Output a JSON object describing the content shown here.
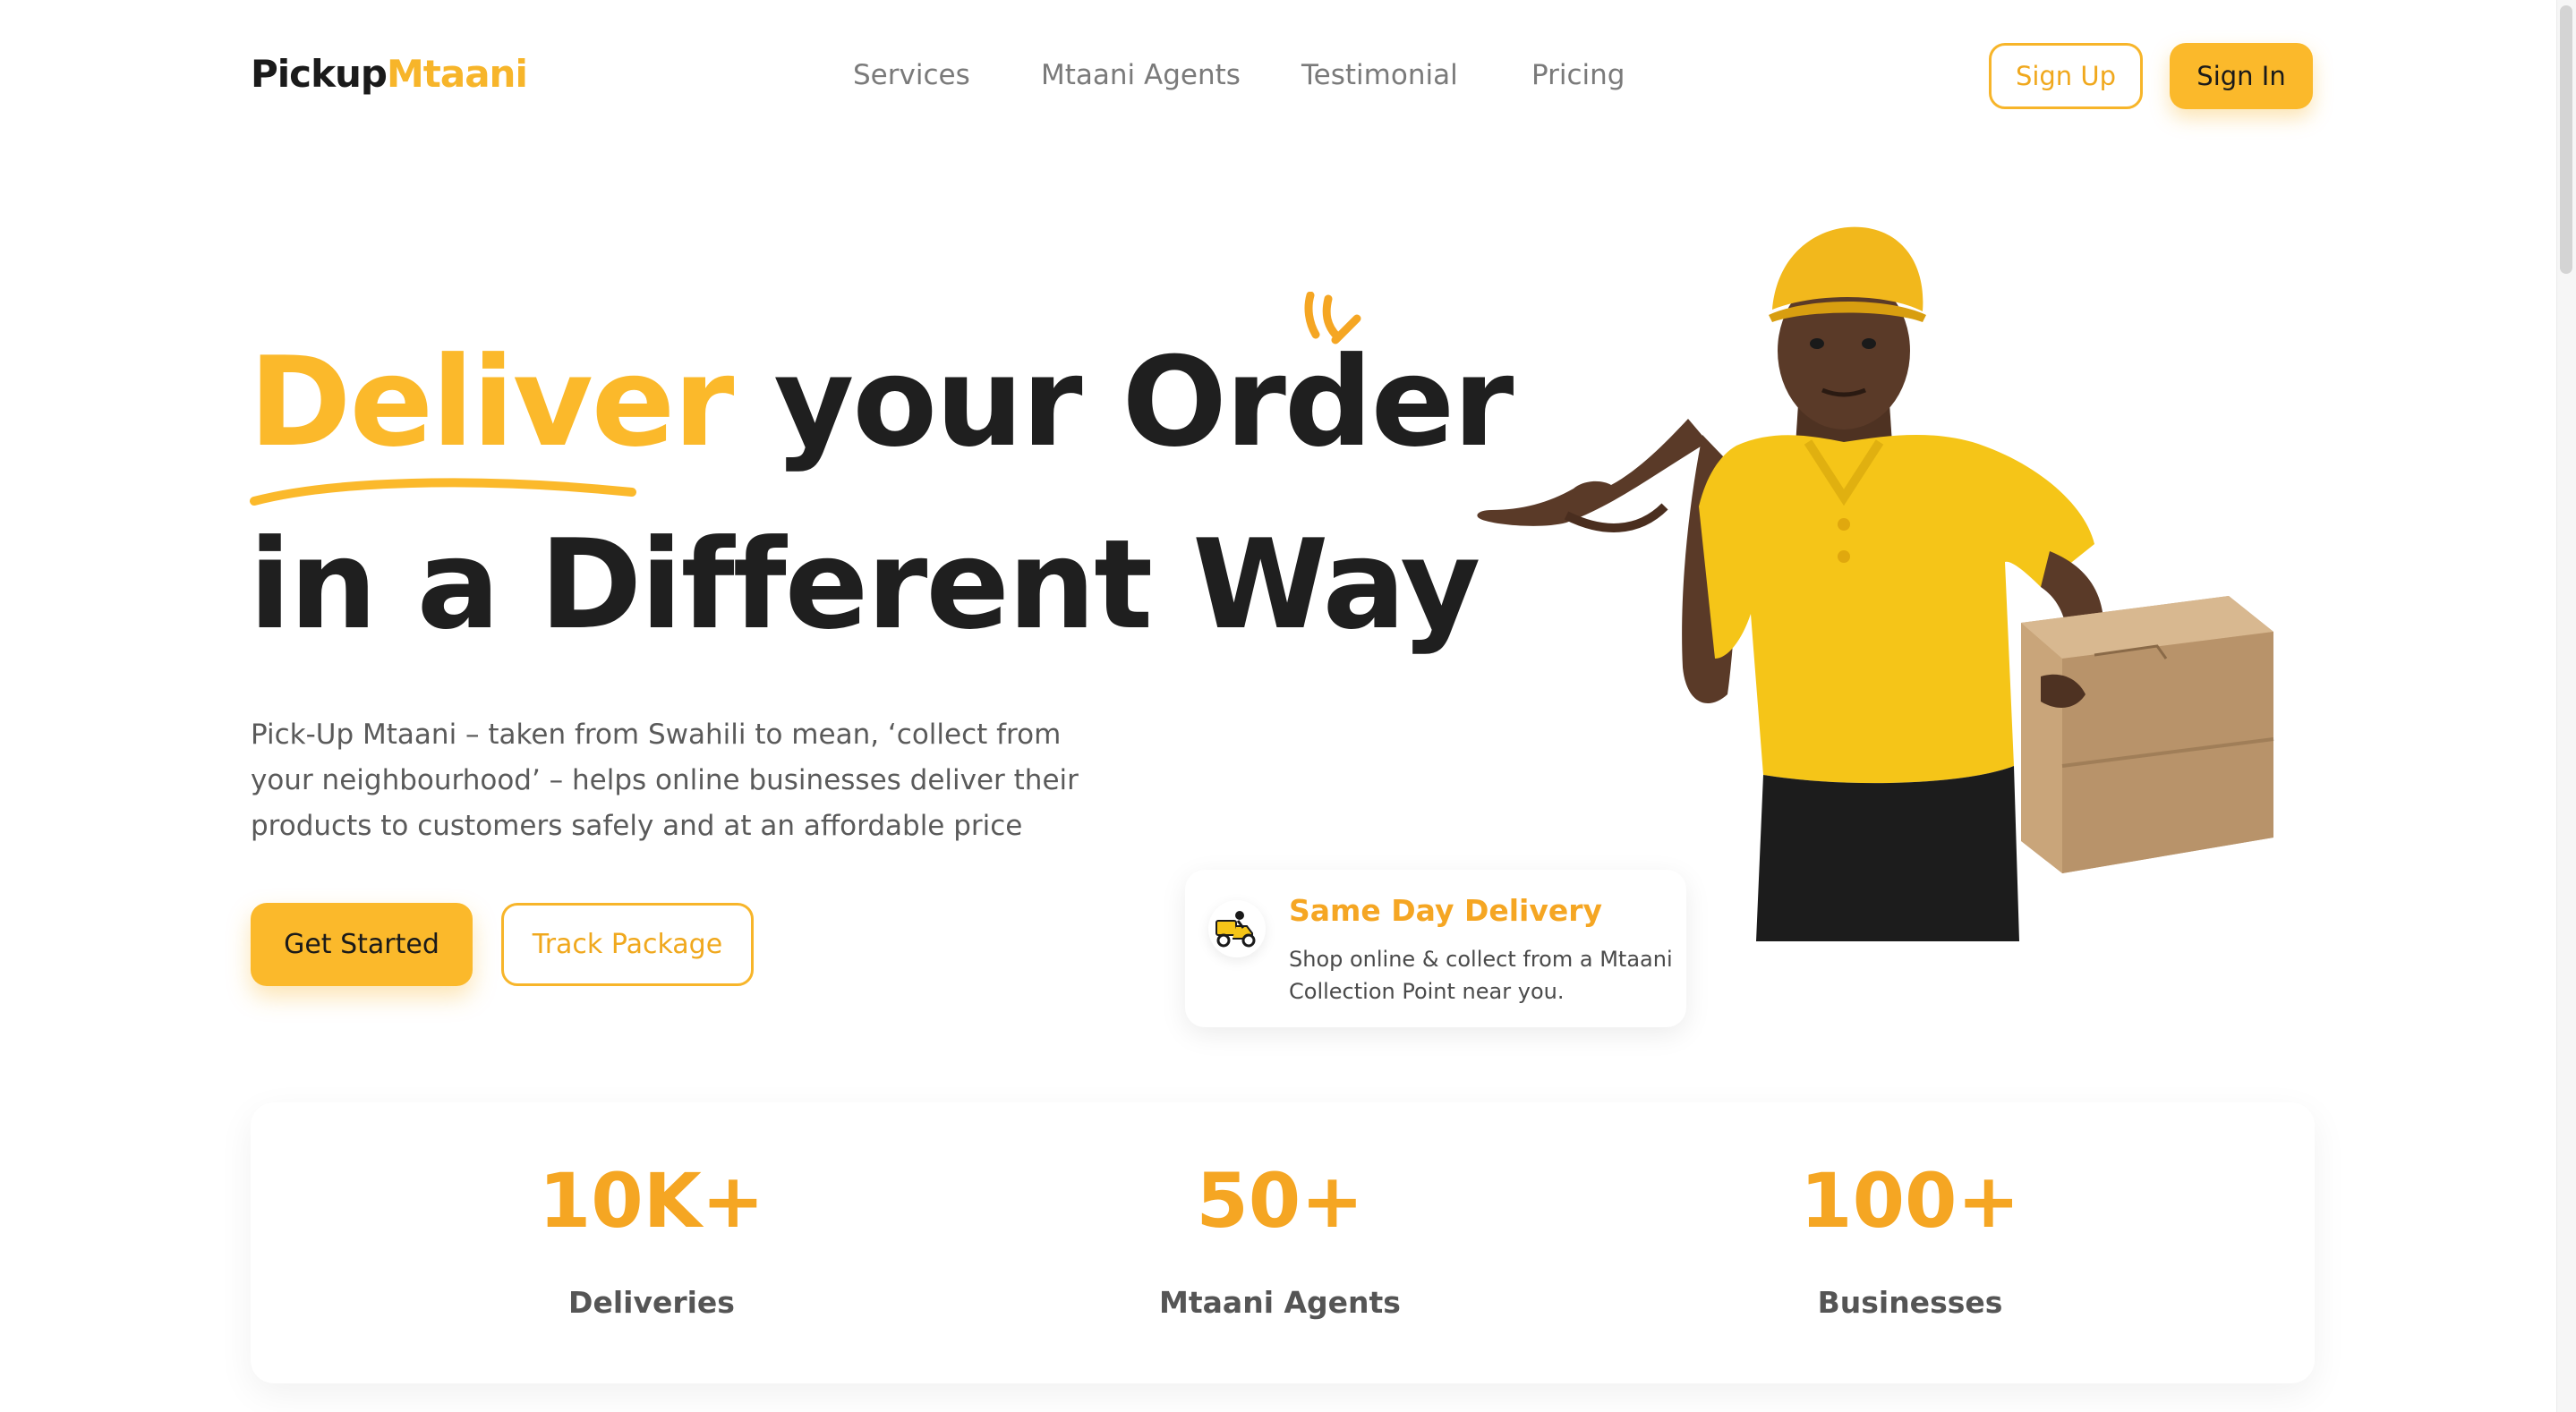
{
  "brand": {
    "part1": "Pickup",
    "part2": "Mtaani"
  },
  "nav": {
    "items": [
      {
        "label": "Services"
      },
      {
        "label": "Mtaani Agents"
      },
      {
        "label": "Testimonial"
      },
      {
        "label": "Pricing"
      }
    ],
    "sign_up": "Sign Up",
    "sign_in": "Sign In"
  },
  "hero": {
    "title_highlight": "Deliver",
    "title_rest": " your Order",
    "title_line2": "in a Different Way",
    "description": "Pick-Up Mtaani – taken from Swahili to mean, ‘collect from your neighbourhood’ – helps online businesses deliver their products to customers safely and at an affordable price",
    "cta_primary": "Get Started",
    "cta_secondary": "Track Package"
  },
  "feature_card": {
    "icon": "delivery-scooter-icon",
    "title": "Same Day Delivery",
    "description": "Shop online & collect from a Mtaani Collection Point near you."
  },
  "stats": [
    {
      "value": "10K+",
      "label": "Deliveries"
    },
    {
      "value": "50+",
      "label": "Mtaani Agents"
    },
    {
      "value": "100+",
      "label": "Businesses"
    }
  ],
  "colors": {
    "accent": "#fbb92b",
    "accent_text": "#f5a623",
    "dark": "#1f1f1f",
    "muted": "#7a7a7a"
  }
}
